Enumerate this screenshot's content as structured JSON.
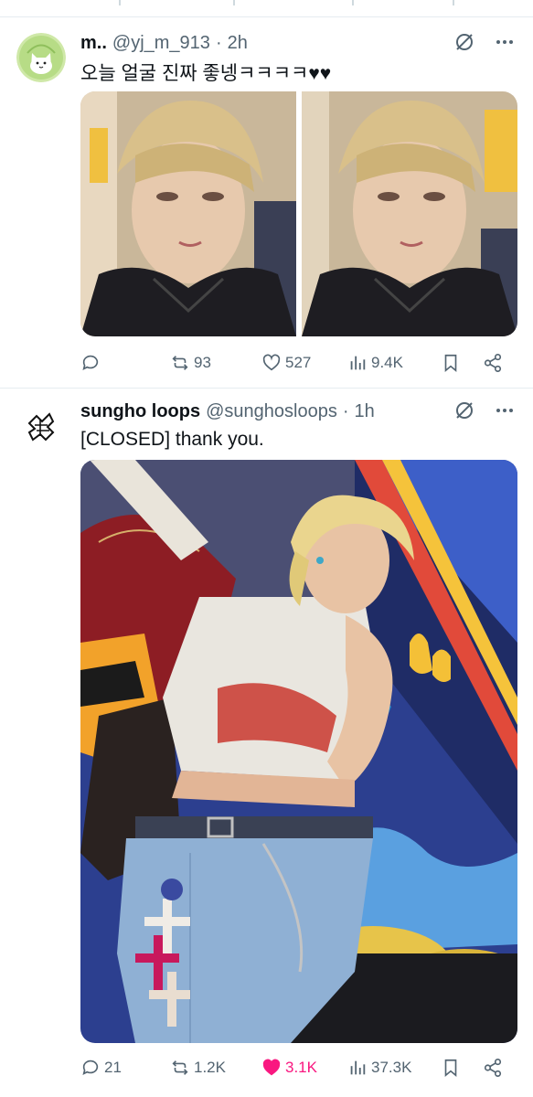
{
  "tweets": [
    {
      "display_name": "m..",
      "handle": "@yj_m_913",
      "dot": "·",
      "time": "2h",
      "text": "오늘 얼굴 진짜 좋넹ㅋㅋㅋㅋ♥♥",
      "actions": {
        "replies": "",
        "retweets": "93",
        "likes": "527",
        "views": "9.4K"
      }
    },
    {
      "display_name": "sungho loops",
      "handle": "@sunghosloops",
      "dot": "·",
      "time": "1h",
      "text": "[CLOSED] thank you.",
      "actions": {
        "replies": "21",
        "retweets": "1.2K",
        "likes": "3.1K",
        "views": "37.3K"
      },
      "liked": true
    }
  ],
  "colors": {
    "like_active": "#f91880",
    "secondary_text": "#536471",
    "divider": "#e6ecf0"
  },
  "icons": [
    "grok-icon",
    "more-icon",
    "reply-icon",
    "retweet-icon",
    "like-icon",
    "views-icon",
    "bookmark-icon",
    "share-icon"
  ]
}
